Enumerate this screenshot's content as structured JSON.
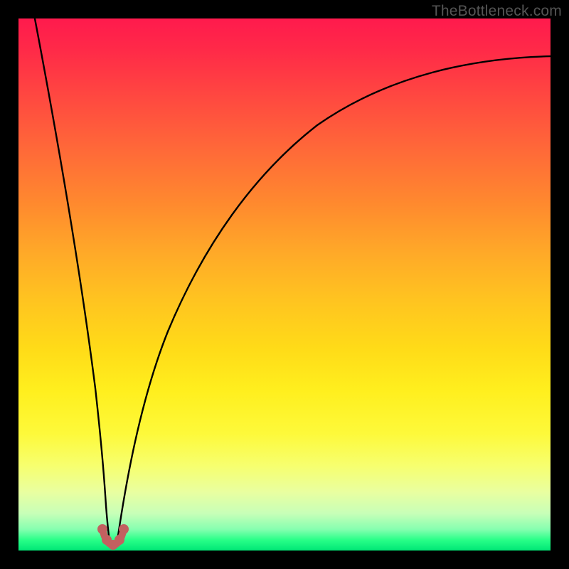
{
  "attribution": "TheBottleneck.com",
  "chart_data": {
    "type": "line",
    "title": "",
    "xlabel": "",
    "ylabel": "",
    "xlim": [
      0,
      100
    ],
    "ylim": [
      0,
      100
    ],
    "series": [
      {
        "name": "curve",
        "x": [
          3,
          5,
          8,
          10,
          12,
          14,
          15,
          16,
          17,
          18,
          19,
          20,
          22,
          25,
          30,
          35,
          40,
          45,
          50,
          55,
          60,
          65,
          70,
          75,
          80,
          85,
          90,
          95,
          100
        ],
        "y": [
          100,
          80,
          55,
          40,
          25,
          12,
          6,
          2,
          0.5,
          0.5,
          2,
          6,
          16,
          30,
          47,
          58,
          66,
          72,
          77,
          81,
          84,
          86.5,
          88.5,
          90,
          91,
          91.8,
          92.3,
          92.6,
          92.8
        ]
      }
    ],
    "markers": [
      {
        "x": 15.8,
        "y": 2.0
      },
      {
        "x": 16.6,
        "y": 0.8
      },
      {
        "x": 17.1,
        "y": 0.5
      },
      {
        "x": 17.8,
        "y": 0.8
      },
      {
        "x": 18.6,
        "y": 2.0
      }
    ],
    "accent_color": "#c26060",
    "curve_color": "#000000"
  }
}
